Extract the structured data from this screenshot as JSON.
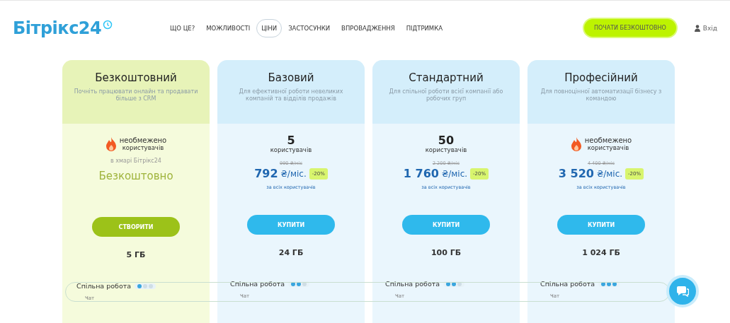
{
  "logo": {
    "text": "Бітрікс24"
  },
  "nav": [
    {
      "label": "ЩО ЦЕ?",
      "selected": false
    },
    {
      "label": "МОЖЛИВОСТІ",
      "selected": false
    },
    {
      "label": "ЦІНИ",
      "selected": true
    },
    {
      "label": "ЗАСТОСУНКИ",
      "selected": false
    },
    {
      "label": "ВПРОВАДЖЕННЯ",
      "selected": false
    },
    {
      "label": "ПІДТРИМКА",
      "selected": false
    }
  ],
  "cta_button": "ПОЧАТИ БЕЗКОШТОВНО",
  "login": "Вхід",
  "plans": [
    {
      "kind": "free",
      "name": "Безкоштовний",
      "description": "Почніть працювати онлайн та продавати більше з CRM",
      "users_count": "необмежено",
      "users_label": "користувачів",
      "unlimited": true,
      "note": "в хмарі Бітрікс24",
      "price": "Безкоштовно",
      "button": "СТВОРИТИ",
      "storage": "5 ГБ",
      "feature": "Спільна робота",
      "stars": 1,
      "feature_item": "Чат"
    },
    {
      "kind": "paid",
      "name": "Базовий",
      "description": "Для ефективної роботи невеликих компаній та відділів продажів",
      "users_count": "5",
      "users_label": "користувачів",
      "unlimited": false,
      "old_price": "990 ₴/міс",
      "price": "792",
      "unit": "₴/міс.",
      "discount": "-20%",
      "price_note": "за всіх користувачів",
      "button": "КУПИТИ",
      "storage": "24 ГБ",
      "feature": "Спільна робота",
      "stars": 2,
      "feature_item": "Чат"
    },
    {
      "kind": "paid",
      "name": "Стандартний",
      "description": "Для спільної роботи всієї компанії або робочих груп",
      "users_count": "50",
      "users_label": "користувачів",
      "unlimited": false,
      "old_price": "2 200 ₴/міс",
      "price": "1 760",
      "unit": "₴/міс.",
      "discount": "-20%",
      "price_note": "за всіх користувачів",
      "button": "КУПИТИ",
      "storage": "100 ГБ",
      "feature": "Спільна робота",
      "stars": 2,
      "feature_item": "Чат"
    },
    {
      "kind": "paid",
      "name": "Професійний",
      "description": "Для повноцінної автоматизації бізнесу з командою",
      "users_count": "необмежено",
      "users_label": "користувачів",
      "unlimited": true,
      "old_price": "4 400 ₴/міс",
      "price": "3 520",
      "unit": "₴/міс.",
      "discount": "-20%",
      "price_note": "за всіх користувачів",
      "button": "КУПИТИ",
      "storage": "1 024 ГБ",
      "feature": "Спільна робота",
      "stars": 3,
      "feature_item": "Чат"
    }
  ]
}
